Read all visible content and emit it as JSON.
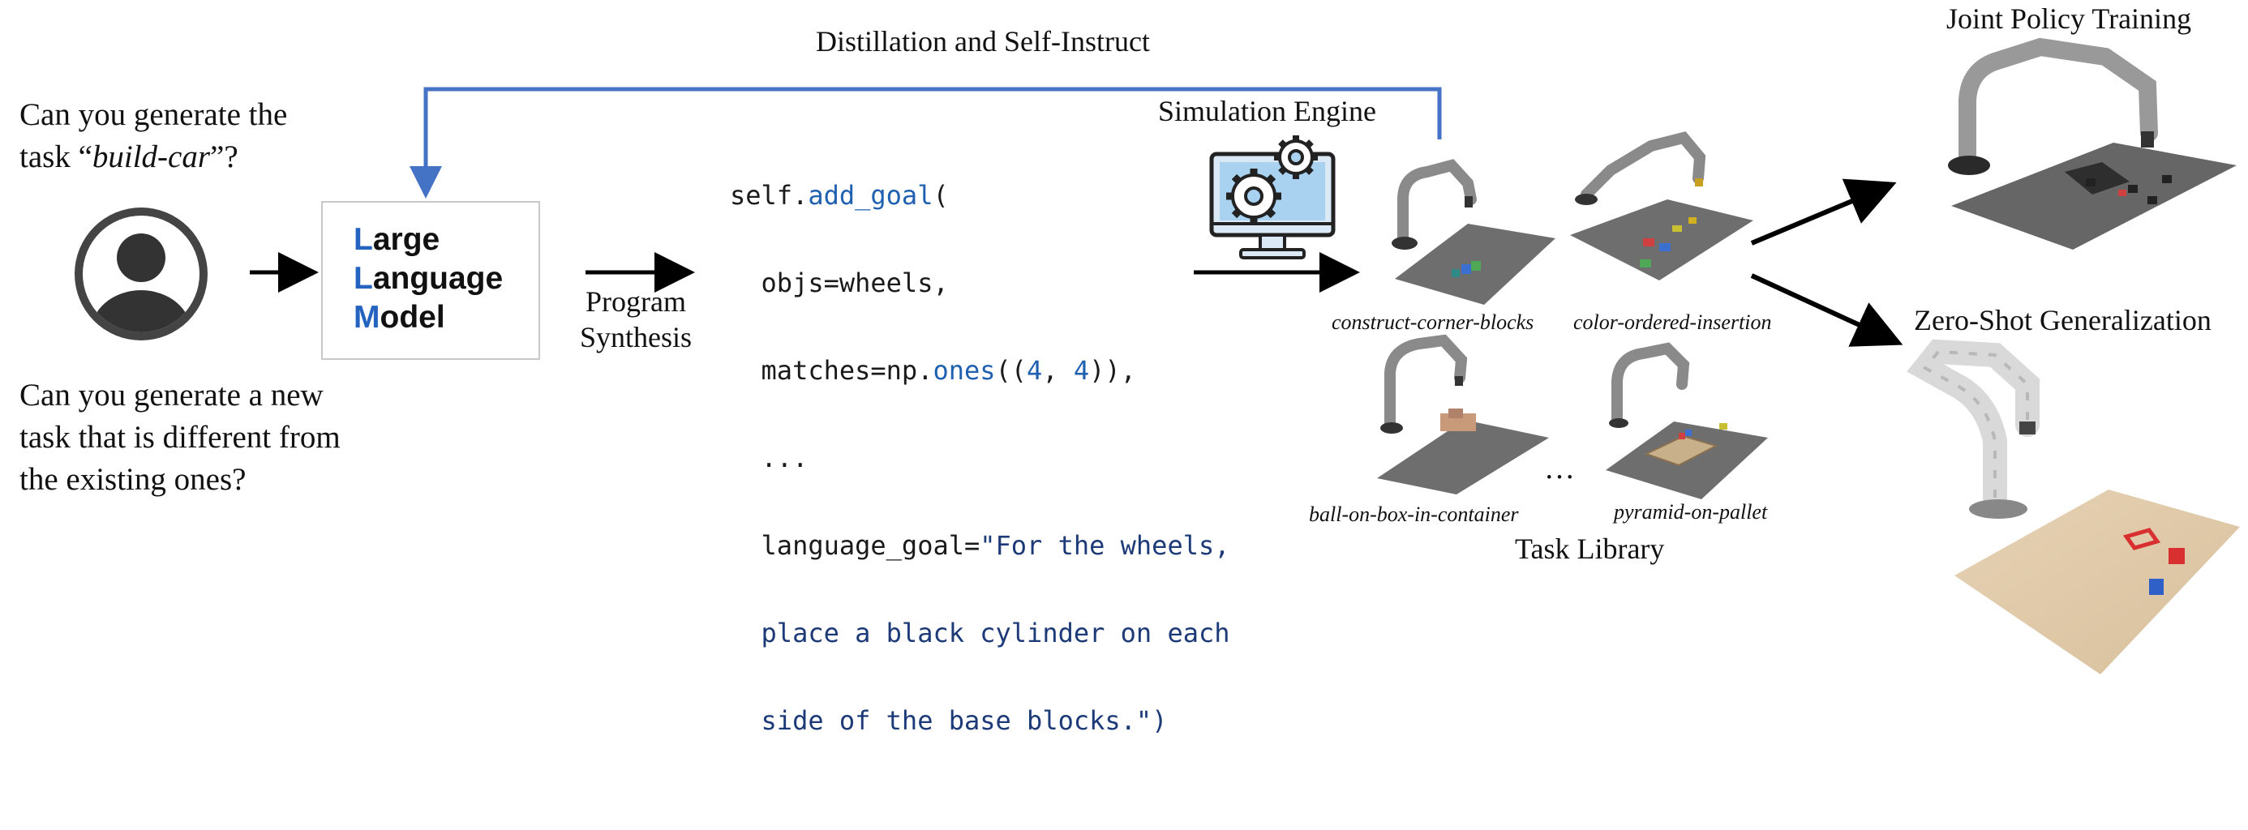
{
  "top_loop_label": "Distillation and Self-Instruct",
  "question_1": {
    "line_1": "Can you generate the",
    "line_2_prefix": "task “",
    "line_2_em": "build-car",
    "line_2_suffix": "”?"
  },
  "question_2": {
    "lines": [
      "Can you generate a new",
      "task that is different from",
      "the existing ones?"
    ]
  },
  "llm": {
    "line_1_initial": "L",
    "line_1_rest": "arge",
    "line_2_initial": "L",
    "line_2_rest": "anguage",
    "line_3_initial": "M",
    "line_3_rest": "odel"
  },
  "program_synthesis": {
    "line_1": "Program",
    "line_2": "Synthesis"
  },
  "code": {
    "l1_a": "self.",
    "l1_b": "add_goal",
    "l1_c": "(",
    "l2": "  objs=wheels,",
    "l3_a": "  matches=np.",
    "l3_b": "ones",
    "l3_c": "((",
    "l3_d": "4",
    "l3_e": ", ",
    "l3_f": "4",
    "l3_g": ")),",
    "l4": "  ...",
    "l5_a": "  language_goal=",
    "l5_b": "\"For the wheels,",
    "l6": "  place a black cylinder on each",
    "l7": "  side of the base blocks.\")"
  },
  "simulation_engine": "Simulation Engine",
  "task_library": {
    "title": "Task Library",
    "tasks": [
      "construct-corner-blocks",
      "color-ordered-insertion",
      "ball-on-box-in-container",
      "pyramid-on-pallet"
    ],
    "ellipsis": "…"
  },
  "joint_policy_training": "Joint Policy Training",
  "zero_shot": "Zero-Shot Generalization",
  "colors": {
    "accent_blue": "#4472c4",
    "llm_blue": "#2563c0",
    "code_blue": "#2060b0"
  }
}
